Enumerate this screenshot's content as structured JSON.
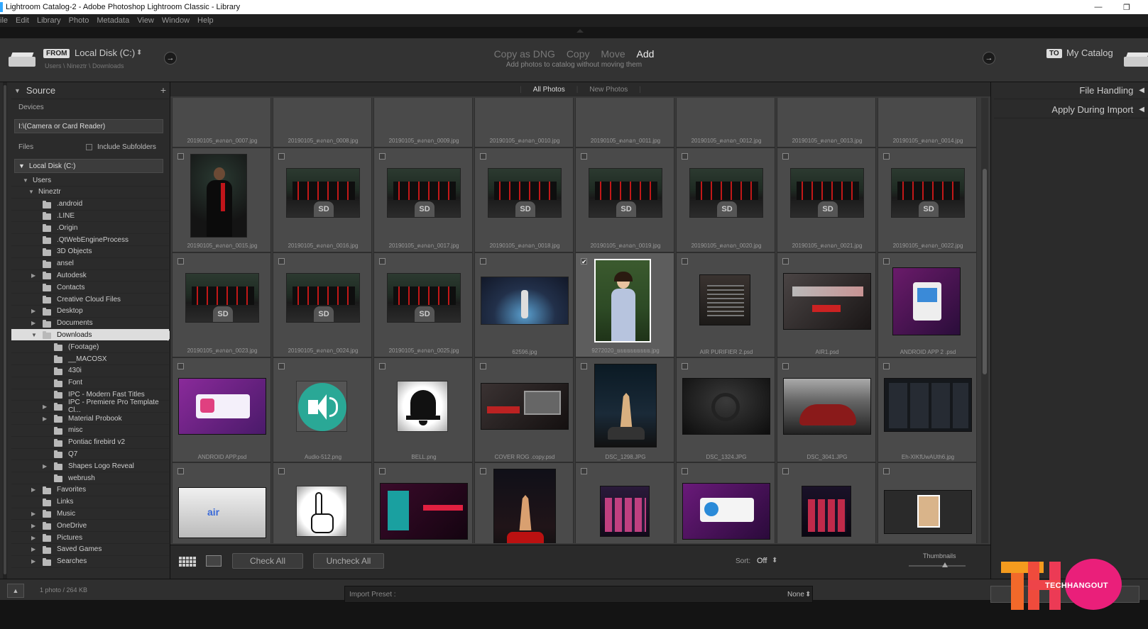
{
  "window": {
    "title": "Lightroom Catalog-2 - Adobe Photoshop Lightroom Classic - Library",
    "minimize": "—",
    "restore": "❐"
  },
  "menu": [
    "ile",
    "Edit",
    "Library",
    "Photo",
    "Metadata",
    "View",
    "Window",
    "Help"
  ],
  "header": {
    "from_tag": "FROM",
    "source_name": "Local Disk (C:)",
    "source_caret": "⬍",
    "source_path": "Users \\ Nineztr \\ Downloads",
    "modes": {
      "copy_dng": "Copy as DNG",
      "copy": "Copy",
      "move": "Move",
      "add": "Add"
    },
    "mode_sub": "Add photos to catalog without moving them",
    "to_tag": "TO",
    "dest_name": "My Catalog",
    "arrow": "→"
  },
  "source_panel": {
    "title": "Source",
    "add": "+",
    "devices_label": "Devices",
    "device": "I:\\(Camera or Card Reader)",
    "files_label": "Files",
    "include_subfolders": "Include Subfolders",
    "local_disk": "Local Disk (C:)",
    "tree": [
      {
        "label": "Users",
        "exp": "▼",
        "level": 0,
        "folder": false
      },
      {
        "label": "Nineztr",
        "exp": "▼",
        "level": 1,
        "folder": false
      },
      {
        "label": ".android",
        "exp": "",
        "level": 2,
        "folder": true
      },
      {
        "label": ".LINE",
        "exp": "",
        "level": 2,
        "folder": true
      },
      {
        "label": ".Origin",
        "exp": "",
        "level": 2,
        "folder": true
      },
      {
        "label": ".QtWebEngineProcess",
        "exp": "",
        "level": 2,
        "folder": true
      },
      {
        "label": "3D Objects",
        "exp": "",
        "level": 2,
        "folder": true
      },
      {
        "label": "ansel",
        "exp": "",
        "level": 2,
        "folder": true
      },
      {
        "label": "Autodesk",
        "exp": "▶",
        "level": 2,
        "folder": true
      },
      {
        "label": "Contacts",
        "exp": "",
        "level": 2,
        "folder": true
      },
      {
        "label": "Creative Cloud Files",
        "exp": "",
        "level": 2,
        "folder": true
      },
      {
        "label": "Desktop",
        "exp": "▶",
        "level": 2,
        "folder": true
      },
      {
        "label": "Documents",
        "exp": "▶",
        "level": 2,
        "folder": true
      },
      {
        "label": "Downloads",
        "exp": "▼",
        "level": 2,
        "folder": true,
        "selected": true
      },
      {
        "label": "(Footage)",
        "exp": "",
        "level": 3,
        "folder": true
      },
      {
        "label": "__MACOSX",
        "exp": "",
        "level": 3,
        "folder": true
      },
      {
        "label": "430i",
        "exp": "",
        "level": 3,
        "folder": true
      },
      {
        "label": "Font",
        "exp": "",
        "level": 3,
        "folder": true
      },
      {
        "label": "IPC - Modern Fast Titles",
        "exp": "",
        "level": 3,
        "folder": true
      },
      {
        "label": "IPC - Premiere Pro Template Cl...",
        "exp": "▶",
        "level": 3,
        "folder": true
      },
      {
        "label": "Material Probook",
        "exp": "▶",
        "level": 3,
        "folder": true
      },
      {
        "label": "misc",
        "exp": "",
        "level": 3,
        "folder": true
      },
      {
        "label": "Pontiac firebird v2",
        "exp": "",
        "level": 3,
        "folder": true
      },
      {
        "label": "Q7",
        "exp": "",
        "level": 3,
        "folder": true
      },
      {
        "label": "Shapes Logo Reveal",
        "exp": "▶",
        "level": 3,
        "folder": true
      },
      {
        "label": "webrush",
        "exp": "",
        "level": 3,
        "folder": true
      },
      {
        "label": "Favorites",
        "exp": "▶",
        "level": 2,
        "folder": true
      },
      {
        "label": "Links",
        "exp": "",
        "level": 2,
        "folder": true
      },
      {
        "label": "Music",
        "exp": "▶",
        "level": 2,
        "folder": true
      },
      {
        "label": "OneDrive",
        "exp": "▶",
        "level": 2,
        "folder": true
      },
      {
        "label": "Pictures",
        "exp": "▶",
        "level": 2,
        "folder": true
      },
      {
        "label": "Saved Games",
        "exp": "▶",
        "level": 2,
        "folder": true
      },
      {
        "label": "Searches",
        "exp": "▶",
        "level": 2,
        "folder": true
      }
    ]
  },
  "center": {
    "tabs": {
      "all": "All Photos",
      "new": "New Photos"
    },
    "rows": [
      [
        {
          "name": "20190105_ตงกอก_0007.jpg",
          "kind": "portrait-crop",
          "checked": false
        },
        {
          "name": "20190105_ตงกอก_0008.jpg",
          "kind": "portrait-crop",
          "checked": false
        },
        {
          "name": "20190105_ตงกอก_0009.jpg",
          "kind": "wide-crop",
          "checked": false
        },
        {
          "name": "20190105_ตงกอก_0010.jpg",
          "kind": "wide-crop",
          "checked": false
        },
        {
          "name": "20190105_ตงกอก_0011.jpg",
          "kind": "wide-crop",
          "checked": false
        },
        {
          "name": "20190105_ตงกอก_0012.jpg",
          "kind": "portrait-crop",
          "checked": false
        },
        {
          "name": "20190105_ตงกอก_0013.jpg",
          "kind": "portrait-crop",
          "checked": false
        },
        {
          "name": "20190105_ตงกอก_0014.jpg",
          "kind": "portrait-crop",
          "checked": false
        }
      ],
      [
        {
          "name": "20190105_ตงกอก_0015.jpg",
          "kind": "portrait",
          "checked": false
        },
        {
          "name": "20190105_ตงกอก_0016.jpg",
          "kind": "group",
          "checked": false
        },
        {
          "name": "20190105_ตงกอก_0017.jpg",
          "kind": "group",
          "checked": false
        },
        {
          "name": "20190105_ตงกอก_0018.jpg",
          "kind": "group",
          "checked": false
        },
        {
          "name": "20190105_ตงกอก_0019.jpg",
          "kind": "group",
          "checked": false
        },
        {
          "name": "20190105_ตงกอก_0020.jpg",
          "kind": "group",
          "checked": false
        },
        {
          "name": "20190105_ตงกอก_0021.jpg",
          "kind": "group",
          "checked": false
        },
        {
          "name": "20190105_ตงกอก_0022.jpg",
          "kind": "group",
          "checked": false
        }
      ],
      [
        {
          "name": "20190105_ตงกอก_0023.jpg",
          "kind": "group",
          "checked": false
        },
        {
          "name": "20190105_ตงกอก_0024.jpg",
          "kind": "group",
          "checked": false
        },
        {
          "name": "20190105_ตงกอก_0025.jpg",
          "kind": "group",
          "checked": false
        },
        {
          "name": "62596.jpg",
          "kind": "stage",
          "checked": false
        },
        {
          "name": "9272020_ยยยยยยยยยย.jpg",
          "kind": "girl",
          "checked": true
        },
        {
          "name": "AIR PURIFIER 2.psd",
          "kind": "product-dark",
          "checked": false
        },
        {
          "name": "AIR1.psd",
          "kind": "ad-red",
          "checked": false
        },
        {
          "name": "ANDROID APP 2 .psd",
          "kind": "android2",
          "checked": false
        }
      ],
      [
        {
          "name": "ANDROID APP.psd",
          "kind": "android",
          "checked": false
        },
        {
          "name": "Audio-512.png",
          "kind": "audio",
          "checked": false
        },
        {
          "name": "BELL.png",
          "kind": "bell",
          "checked": false
        },
        {
          "name": "COVER ROG .copy.psd",
          "kind": "rog",
          "checked": false
        },
        {
          "name": "DSC_1298.JPG",
          "kind": "night",
          "checked": false
        },
        {
          "name": "DSC_1324.JPG",
          "kind": "car-interior",
          "checked": false
        },
        {
          "name": "DSC_3041.JPG",
          "kind": "car-red",
          "checked": false
        },
        {
          "name": "Eh-XIKfUwAUth6.jpg",
          "kind": "apple",
          "checked": false
        }
      ],
      [
        {
          "name": "",
          "kind": "laptop",
          "checked": false
        },
        {
          "name": "",
          "kind": "hand",
          "checked": false
        },
        {
          "name": "",
          "kind": "oneplus",
          "checked": false
        },
        {
          "name": "",
          "kind": "night2",
          "checked": false
        },
        {
          "name": "",
          "kind": "appgrid",
          "checked": false
        },
        {
          "name": "",
          "kind": "ios",
          "checked": false
        },
        {
          "name": "",
          "kind": "appgrid2",
          "checked": false
        },
        {
          "name": "",
          "kind": "frame",
          "checked": false
        }
      ]
    ],
    "toolbar": {
      "check_all": "Check All",
      "uncheck_all": "Uncheck All",
      "sort_label": "Sort:",
      "sort_value": "Off",
      "sort_caret": "⬍",
      "thumbnails": "Thumbnails"
    }
  },
  "right_panel": {
    "file_handling": "File Handling",
    "apply_during_import": "Apply During Import",
    "collapse": "◀"
  },
  "bottom": {
    "status": "1 photo / 264 KB",
    "preset_label": "Import Preset :",
    "preset_value": "None",
    "preset_caret": "⬍",
    "up": "▲"
  },
  "watermark": {
    "text": "TECHHANGOUT"
  },
  "colors": {
    "selected_cell": "#5d5d5d",
    "highlight_row": "#dddddd",
    "brand_pink": "#ea1f7a",
    "brand_orange": "#f49b1e"
  }
}
